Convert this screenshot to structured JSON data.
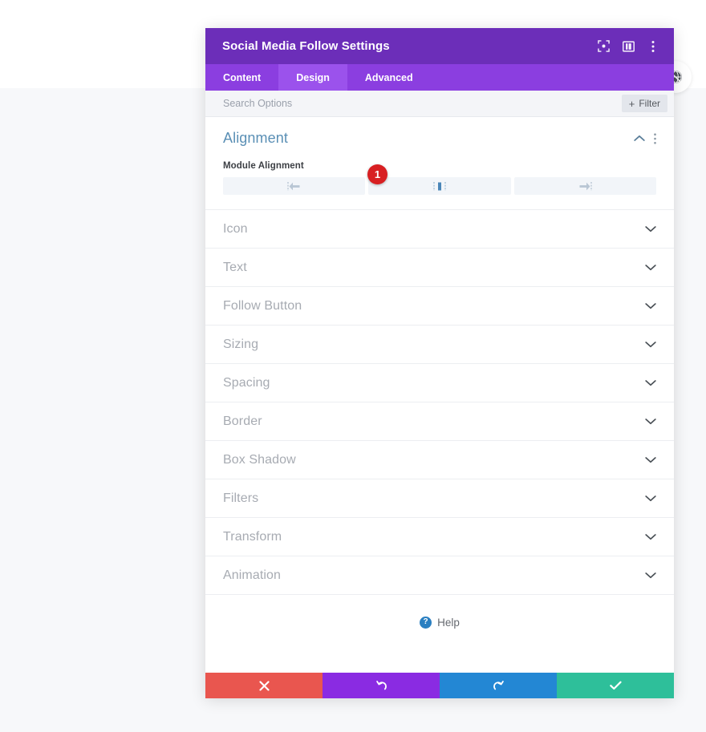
{
  "window": {
    "title": "Social Media Follow Settings",
    "header_icons": [
      {
        "name": "expand-icon",
        "label": "Expand"
      },
      {
        "name": "layout-columns-icon",
        "label": "Layout"
      },
      {
        "name": "kebab-menu-icon",
        "label": "More options"
      }
    ]
  },
  "tabs": [
    {
      "label": "Content",
      "active": false
    },
    {
      "label": "Design",
      "active": true
    },
    {
      "label": "Advanced",
      "active": false
    }
  ],
  "search": {
    "placeholder": "Search Options",
    "value": "",
    "filter_label": "Filter",
    "filter_plus": "+"
  },
  "alignment_section": {
    "title": "Alignment",
    "field_label": "Module Alignment",
    "marker_number": "1",
    "options": [
      {
        "name": "align-left",
        "selected": false
      },
      {
        "name": "align-center",
        "selected": true
      },
      {
        "name": "align-right",
        "selected": false
      }
    ]
  },
  "toggle_sections": [
    {
      "label": "Icon"
    },
    {
      "label": "Text"
    },
    {
      "label": "Follow Button"
    },
    {
      "label": "Sizing"
    },
    {
      "label": "Spacing"
    },
    {
      "label": "Border"
    },
    {
      "label": "Box Shadow"
    },
    {
      "label": "Filters"
    },
    {
      "label": "Transform"
    },
    {
      "label": "Animation"
    }
  ],
  "help": {
    "label": "Help",
    "icon_glyph": "?"
  },
  "footer": {
    "buttons": [
      {
        "name": "cancel-button",
        "glyph": "✖",
        "color": "#e9564f"
      },
      {
        "name": "undo-button",
        "glyph": "↺",
        "color": "#8a2be2"
      },
      {
        "name": "redo-button",
        "glyph": "↻",
        "color": "#2387d4"
      },
      {
        "name": "save-button",
        "glyph": "✔",
        "color": "#2ebf9a"
      }
    ]
  },
  "floating": {
    "globe_icon": "globe-icon",
    "dark_circle": "circle-handle"
  },
  "colors": {
    "header_purple": "#6c2eb9",
    "tabbar_purple": "#8b3ee0",
    "tab_active_purple": "#9b52ec",
    "section_title_blue": "#5a8fb5",
    "marker_red": "#d81f22"
  }
}
